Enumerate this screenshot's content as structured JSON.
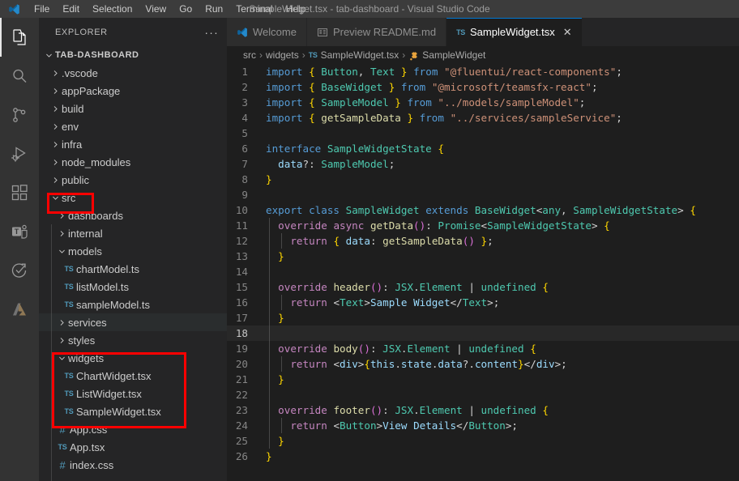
{
  "titlebar": {
    "logo_icon": "vscode-logo-icon",
    "window_title": "SampleWidget.tsx - tab-dashboard - Visual Studio Code",
    "menu": [
      "File",
      "Edit",
      "Selection",
      "View",
      "Go",
      "Run",
      "Terminal",
      "Help"
    ]
  },
  "activitybar": {
    "items": [
      {
        "name": "explorer",
        "icon": "files-icon",
        "active": true
      },
      {
        "name": "search",
        "icon": "search-icon",
        "active": false
      },
      {
        "name": "source-control",
        "icon": "source-control-icon",
        "active": false
      },
      {
        "name": "run-and-debug",
        "icon": "run-debug-icon",
        "active": false
      },
      {
        "name": "extensions",
        "icon": "extensions-icon",
        "active": false
      },
      {
        "name": "teams-toolkit",
        "icon": "teams-toolkit-icon",
        "active": false
      },
      {
        "name": "testing",
        "icon": "testing-beaker-icon",
        "active": false
      },
      {
        "name": "azure",
        "icon": "azure-icon",
        "active": false
      }
    ]
  },
  "sidebar": {
    "title": "EXPLORER",
    "more_actions": "···",
    "tree": [
      {
        "label": "TAB-DASHBOARD",
        "kind": "root",
        "indent": 0,
        "expanded": true
      },
      {
        "label": ".vscode",
        "kind": "folder",
        "indent": 1,
        "expanded": false
      },
      {
        "label": "appPackage",
        "kind": "folder",
        "indent": 1,
        "expanded": false
      },
      {
        "label": "build",
        "kind": "folder",
        "indent": 1,
        "expanded": false
      },
      {
        "label": "env",
        "kind": "folder",
        "indent": 1,
        "expanded": false
      },
      {
        "label": "infra",
        "kind": "folder",
        "indent": 1,
        "expanded": false
      },
      {
        "label": "node_modules",
        "kind": "folder",
        "indent": 1,
        "expanded": false
      },
      {
        "label": "public",
        "kind": "folder",
        "indent": 1,
        "expanded": false
      },
      {
        "label": "src",
        "kind": "folder",
        "indent": 1,
        "expanded": true,
        "annotated": true
      },
      {
        "label": "dashboards",
        "kind": "folder",
        "indent": 2,
        "expanded": false
      },
      {
        "label": "internal",
        "kind": "folder",
        "indent": 2,
        "expanded": false
      },
      {
        "label": "models",
        "kind": "folder",
        "indent": 2,
        "expanded": true
      },
      {
        "label": "chartModel.ts",
        "kind": "ts",
        "indent": 3
      },
      {
        "label": "listModel.ts",
        "kind": "ts",
        "indent": 3
      },
      {
        "label": "sampleModel.ts",
        "kind": "ts",
        "indent": 3
      },
      {
        "label": "services",
        "kind": "folder",
        "indent": 2,
        "expanded": false,
        "hovered": true
      },
      {
        "label": "styles",
        "kind": "folder",
        "indent": 2,
        "expanded": false
      },
      {
        "label": "widgets",
        "kind": "folder",
        "indent": 2,
        "expanded": true
      },
      {
        "label": "ChartWidget.tsx",
        "kind": "ts",
        "indent": 3
      },
      {
        "label": "ListWidget.tsx",
        "kind": "ts",
        "indent": 3
      },
      {
        "label": "SampleWidget.tsx",
        "kind": "ts",
        "indent": 3
      },
      {
        "label": "App.css",
        "kind": "css",
        "indent": 2
      },
      {
        "label": "App.tsx",
        "kind": "ts",
        "indent": 2
      },
      {
        "label": "index.css",
        "kind": "css",
        "indent": 2
      }
    ],
    "annotation_color": "#ff0000"
  },
  "editor": {
    "tabs": [
      {
        "label": "Welcome",
        "icon": "vscode-logo-icon",
        "active": false,
        "closable": false
      },
      {
        "label": "Preview README.md",
        "icon": "preview-icon",
        "active": false,
        "closable": false
      },
      {
        "label": "SampleWidget.tsx",
        "icon": "ts-file-icon",
        "active": true,
        "closable": true,
        "close_label": "✕"
      }
    ],
    "breadcrumb": [
      {
        "label": "src",
        "icon": null
      },
      {
        "label": "widgets",
        "icon": null
      },
      {
        "label": "SampleWidget.tsx",
        "icon": "ts-file-icon"
      },
      {
        "label": "SampleWidget",
        "icon": "class-symbol-icon"
      }
    ],
    "breadcrumb_separator": "›",
    "current_line": 18,
    "lines": [
      {
        "n": 1,
        "text": "import { Button, Text } from \"@fluentui/react-components\";"
      },
      {
        "n": 2,
        "text": "import { BaseWidget } from \"@microsoft/teamsfx-react\";"
      },
      {
        "n": 3,
        "text": "import { SampleModel } from \"../models/sampleModel\";"
      },
      {
        "n": 4,
        "text": "import { getSampleData } from \"../services/sampleService\";"
      },
      {
        "n": 5,
        "text": ""
      },
      {
        "n": 6,
        "text": "interface SampleWidgetState {"
      },
      {
        "n": 7,
        "text": "  data?: SampleModel;"
      },
      {
        "n": 8,
        "text": "}"
      },
      {
        "n": 9,
        "text": ""
      },
      {
        "n": 10,
        "text": "export class SampleWidget extends BaseWidget<any, SampleWidgetState> {"
      },
      {
        "n": 11,
        "text": "  override async getData(): Promise<SampleWidgetState> {"
      },
      {
        "n": 12,
        "text": "    return { data: getSampleData() };"
      },
      {
        "n": 13,
        "text": "  }"
      },
      {
        "n": 14,
        "text": ""
      },
      {
        "n": 15,
        "text": "  override header(): JSX.Element | undefined {"
      },
      {
        "n": 16,
        "text": "    return <Text>Sample Widget</Text>;"
      },
      {
        "n": 17,
        "text": "  }"
      },
      {
        "n": 18,
        "text": ""
      },
      {
        "n": 19,
        "text": "  override body(): JSX.Element | undefined {"
      },
      {
        "n": 20,
        "text": "    return <div>{this.state.data?.content}</div>;"
      },
      {
        "n": 21,
        "text": "  }"
      },
      {
        "n": 22,
        "text": ""
      },
      {
        "n": 23,
        "text": "  override footer(): JSX.Element | undefined {"
      },
      {
        "n": 24,
        "text": "    return <Button>View Details</Button>;"
      },
      {
        "n": 25,
        "text": "  }"
      },
      {
        "n": 26,
        "text": "}"
      }
    ]
  }
}
